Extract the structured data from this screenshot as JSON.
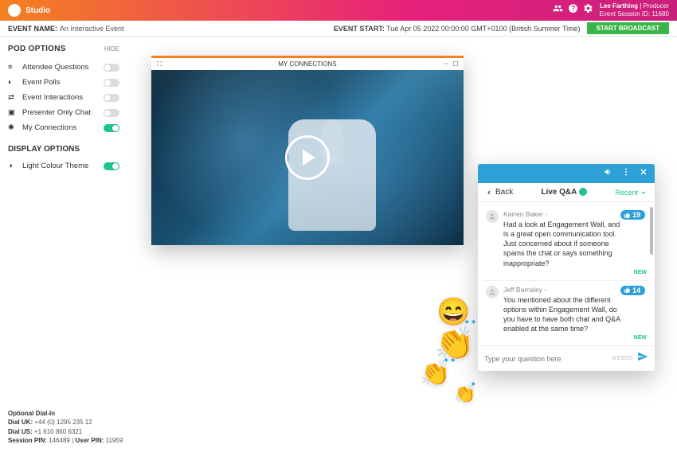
{
  "header": {
    "brand": "Studio",
    "user_name": "Lee Farthing",
    "user_role": "Producer",
    "session_id_label": "Event Session ID: 11680"
  },
  "event_bar": {
    "name_label": "EVENT NAME:",
    "name_value": "An Interactive Event",
    "start_label": "EVENT START:",
    "start_value": "Tue Apr 05 2022 00:00:00 GMT+0100 (British Summer Time)",
    "broadcast_btn": "START BROADCAST"
  },
  "sidebar": {
    "pod_heading": "POD OPTIONS",
    "hide": "HIDE",
    "display_heading": "DISPLAY OPTIONS",
    "items": [
      {
        "label": "Attendee Questions",
        "on": false
      },
      {
        "label": "Event Polls",
        "on": false
      },
      {
        "label": "Event Interactions",
        "on": false
      },
      {
        "label": "Presenter Only Chat",
        "on": false
      },
      {
        "label": "My Connections",
        "on": true
      }
    ],
    "display_items": [
      {
        "label": "Light Colour Theme",
        "on": true
      }
    ]
  },
  "dial": {
    "heading": "Optional Dial-In",
    "uk_label": "Dial UK:",
    "uk_value": "+44 (0) 1295 235 12",
    "us_label": "Dial US:",
    "us_value": "+1 610 860 6321",
    "pin_label": "Session PIN:",
    "pin_value": "146489",
    "user_pin_label": "User PIN:",
    "user_pin_value": "11959"
  },
  "video": {
    "title": "MY CONNECTIONS"
  },
  "qa": {
    "back": "Back",
    "title": "Live Q&A",
    "recent": "Recent",
    "input_placeholder": "Type your question here",
    "counter": "0/10000",
    "items": [
      {
        "name": "Karren Baker",
        "text": "Had a look at Engagement Wall, and is a great open communication tool. Just concerned about if someone spams the chat or says something inappropriate?",
        "likes": "19",
        "new": "NEW"
      },
      {
        "name": "Jeff Barnsley",
        "text": "You mentioned about the different options within Engagement Wall, do you have to have both chat and Q&A enabled at the same time?",
        "likes": "14",
        "new": "NEW"
      }
    ]
  }
}
